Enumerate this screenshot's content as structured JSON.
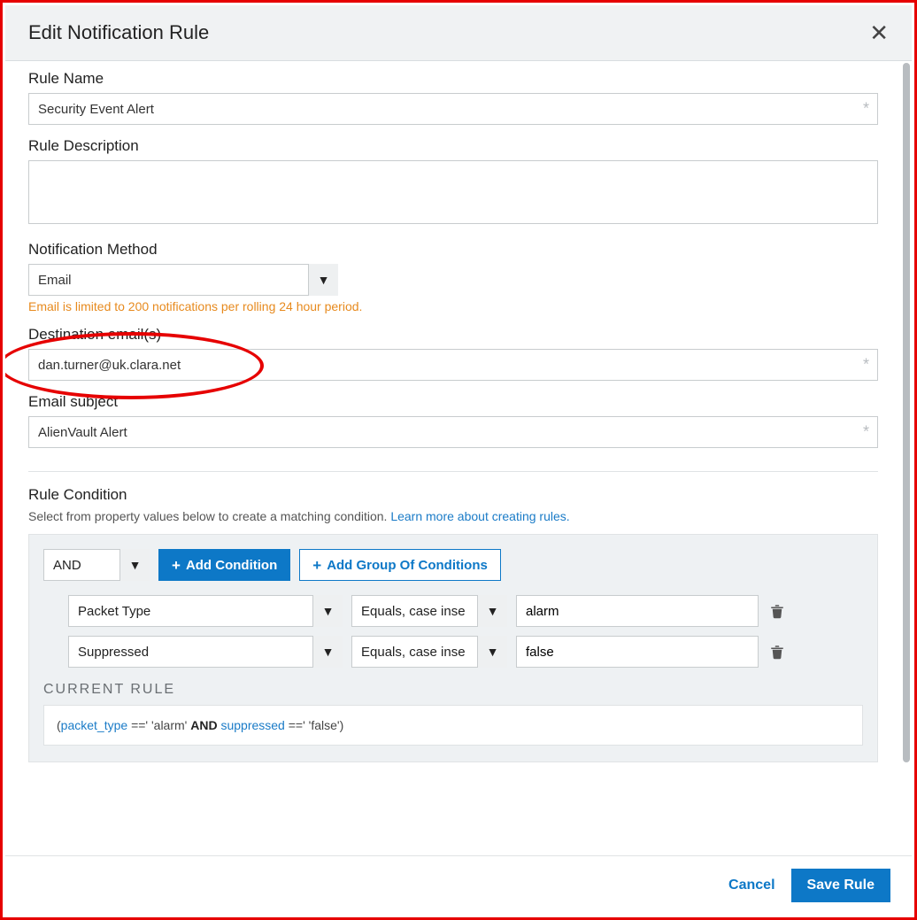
{
  "header": {
    "title": "Edit Notification Rule"
  },
  "form": {
    "rule_name": {
      "label": "Rule Name",
      "value": "Security Event Alert"
    },
    "rule_description": {
      "label": "Rule Description",
      "value": ""
    },
    "notification_method": {
      "label": "Notification Method",
      "value": "Email",
      "helper": "Email is limited to 200 notifications per rolling 24 hour period."
    },
    "destination_emails": {
      "label": "Destination email(s)",
      "value": "dan.turner@uk.clara.net"
    },
    "email_subject": {
      "label": "Email subject",
      "value": "AlienVault Alert"
    }
  },
  "condition": {
    "section_label": "Rule Condition",
    "sub_text": "Select from property values below to create a matching condition. ",
    "learn_more": "Learn more about creating rules.",
    "logic_value": "AND",
    "buttons": {
      "add_condition": "Add Condition",
      "add_group": "Add Group Of Conditions"
    },
    "rows": [
      {
        "property": "Packet Type",
        "operator": "Equals, case inse",
        "value": "alarm"
      },
      {
        "property": "Suppressed",
        "operator": "Equals, case inse",
        "value": "false"
      }
    ],
    "current_rule_label": "CURRENT RULE",
    "current_rule": {
      "field1": "packet_type",
      "val1": "'alarm'",
      "bool": "AND",
      "field2": "suppressed",
      "val2": "'false'"
    }
  },
  "footer": {
    "cancel": "Cancel",
    "save": "Save Rule"
  }
}
